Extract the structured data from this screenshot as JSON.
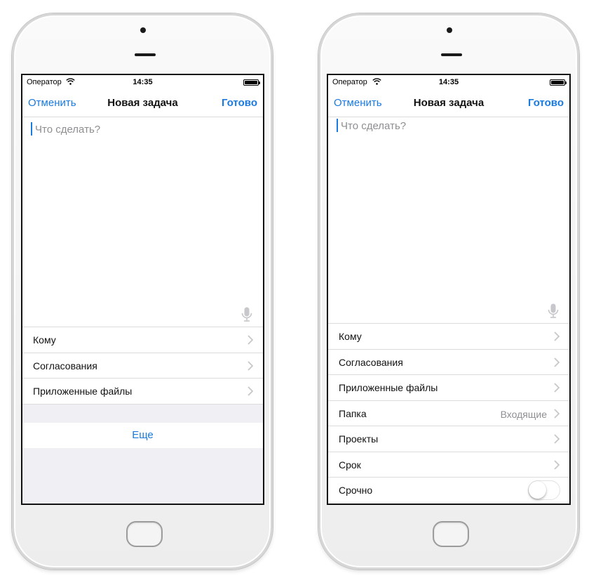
{
  "status_bar": {
    "carrier": "Оператор",
    "time": "14:35"
  },
  "nav": {
    "cancel": "Отменить",
    "title": "Новая задача",
    "done": "Готово"
  },
  "task_input": {
    "placeholder": "Что сделать?"
  },
  "left_screen": {
    "rows": [
      {
        "label": "Кому"
      },
      {
        "label": "Согласования"
      },
      {
        "label": "Приложенные файлы"
      }
    ],
    "more_button": "Еще"
  },
  "right_screen": {
    "rows": [
      {
        "label": "Кому"
      },
      {
        "label": "Согласования"
      },
      {
        "label": "Приложенные файлы"
      },
      {
        "label": "Папка",
        "value": "Входящие"
      },
      {
        "label": "Проекты"
      },
      {
        "label": "Срок"
      }
    ],
    "urgent": {
      "label": "Срочно",
      "enabled": false
    }
  },
  "colors": {
    "accent": "#1a7ae0",
    "separator": "#dcdcdc",
    "group_background": "#efeff4",
    "secondary_text": "#8e8e93"
  }
}
